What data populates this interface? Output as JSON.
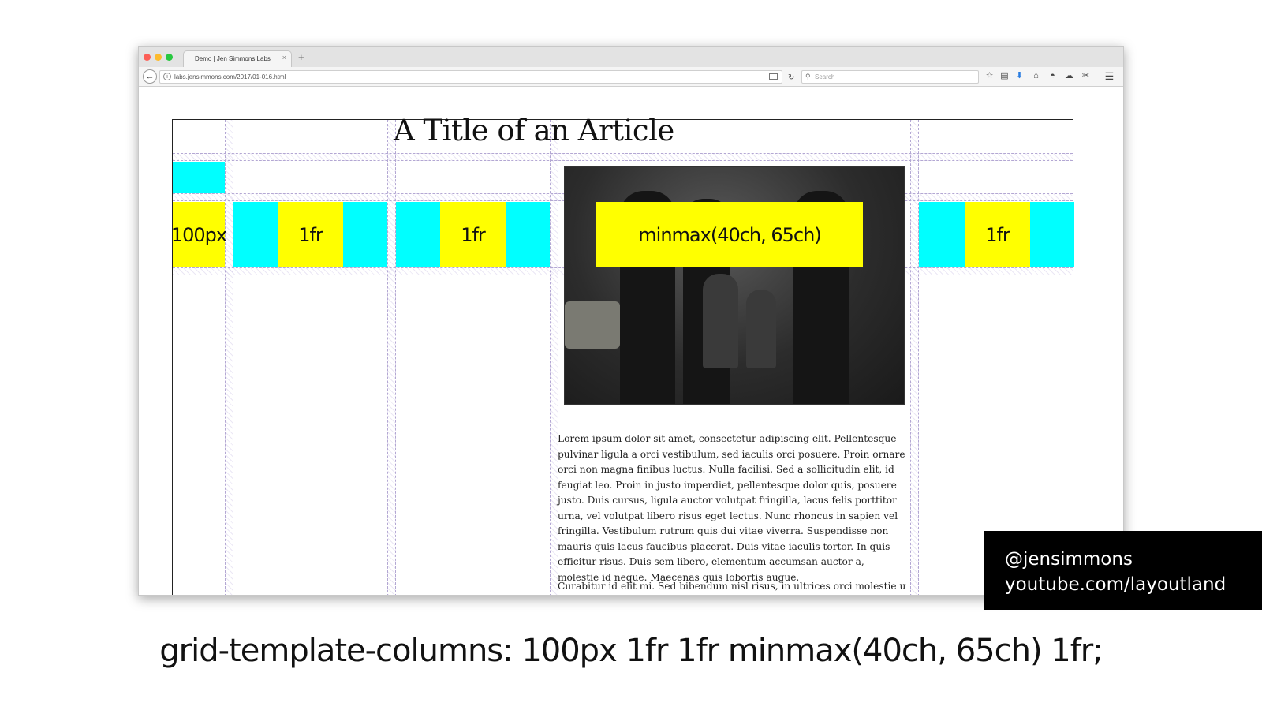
{
  "browser": {
    "tab_title": "Demo | Jen Simmons Labs",
    "tab_close": "×",
    "new_tab": "+",
    "url": "labs.jensimmons.com/2017/01-016.html",
    "search_placeholder": "Search"
  },
  "article": {
    "title": "A Title of an Article",
    "paragraph1": "Lorem ipsum dolor sit amet, consectetur adipiscing elit. Pellentesque pulvinar ligula a orci vestibulum, sed iaculis orci posuere. Proin ornare orci non magna finibus luctus. Nulla facilisi. Sed a sollicitudin elit, id feugiat leo. Proin in justo imperdiet, pellentesque dolor quis, posuere justo. Duis cursus, ligula auctor volutpat fringilla, lacus felis porttitor urna, vel volutpat libero risus eget lectus. Nunc rhoncus in sapien vel fringilla. Vestibulum rutrum quis dui vitae viverra. Suspendisse non mauris quis lacus faucibus placerat. Duis vitae iaculis tortor. In quis efficitur risus. Duis sem libero, elementum accumsan auctor a, molestie id neque. Maecenas quis lobortis augue.",
    "paragraph2": "Curabitur id elit mi. Sed bibendum nisl risus, in ultrices orci molestie ut. Integer"
  },
  "columns": [
    {
      "label": "100px"
    },
    {
      "label": "1fr"
    },
    {
      "label": "1fr"
    },
    {
      "label": "minmax(40ch, 65ch)"
    },
    {
      "label": "1fr"
    }
  ],
  "credit": {
    "handle": "@jensimmons",
    "site": "youtube.com/layoutland"
  },
  "caption": "grid-template-columns: 100px 1fr 1fr minmax(40ch, 65ch) 1fr;"
}
